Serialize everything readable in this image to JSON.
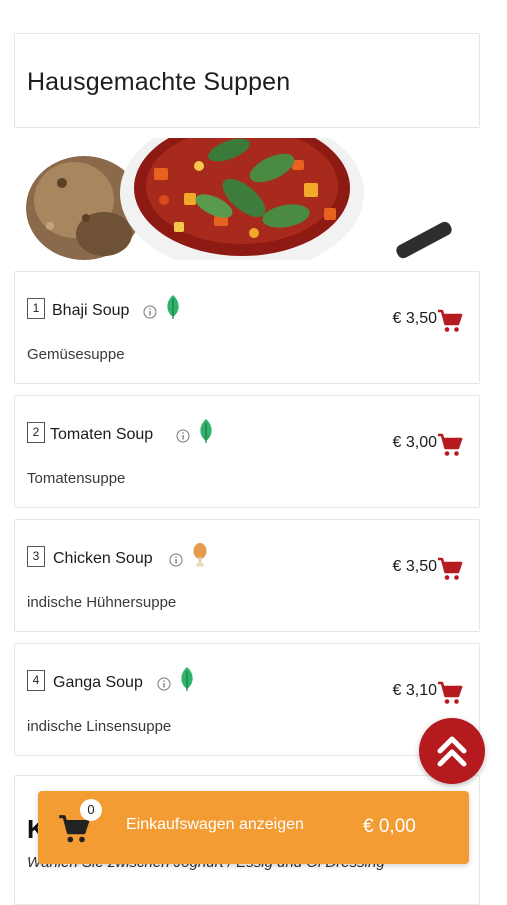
{
  "category": {
    "title": "Hausgemachte Suppen"
  },
  "banner": {
    "image": "soup-bowl-photo"
  },
  "items": [
    {
      "number": "1",
      "name": "Bhaji Soup",
      "description": "Gemüsesuppe",
      "price": "€ 3,50",
      "diet": "leaf-icon"
    },
    {
      "number": "2",
      "name": "Tomaten Soup",
      "description": "Tomatensuppe",
      "price": "€ 3,00",
      "diet": "leaf-icon"
    },
    {
      "number": "3",
      "name": "Chicken Soup",
      "description": "indische Hühnersuppe",
      "price": "€ 3,50",
      "diet": "drumstick-icon"
    },
    {
      "number": "4",
      "name": "Ganga Soup",
      "description": "indische Linsensuppe",
      "price": "€ 3,10",
      "diet": "leaf-icon"
    }
  ],
  "next_category": {
    "title": "K",
    "description": "Wählen Sie zwischen Joghurt / Essig und Öl Dressing"
  },
  "cart": {
    "count": "0",
    "label": "Einkaufswagen anzeigen",
    "total": "€ 0,00"
  },
  "colors": {
    "accent_red": "#b51a1f",
    "cart_orange": "#f39c34",
    "leaf_green": "#2fb36b",
    "drumstick": "#e39a4a"
  }
}
